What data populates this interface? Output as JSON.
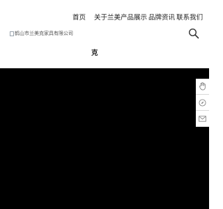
{
  "nav": {
    "items": [
      {
        "label": "首页"
      },
      {
        "label": "关于兰美"
      },
      {
        "label": "产品展示"
      },
      {
        "label": "品牌资讯"
      },
      {
        "label": "联系我们"
      }
    ]
  },
  "logo": {
    "alt_text": "鹤山市兰美克家具有限公司"
  },
  "header": {
    "sub_text": "克"
  },
  "icons": {
    "search": "search-icon",
    "float": [
      "hand-icon",
      "compass-icon",
      "mail-icon"
    ]
  },
  "colors": {
    "hero_background": "#000000",
    "text": "#222222"
  }
}
